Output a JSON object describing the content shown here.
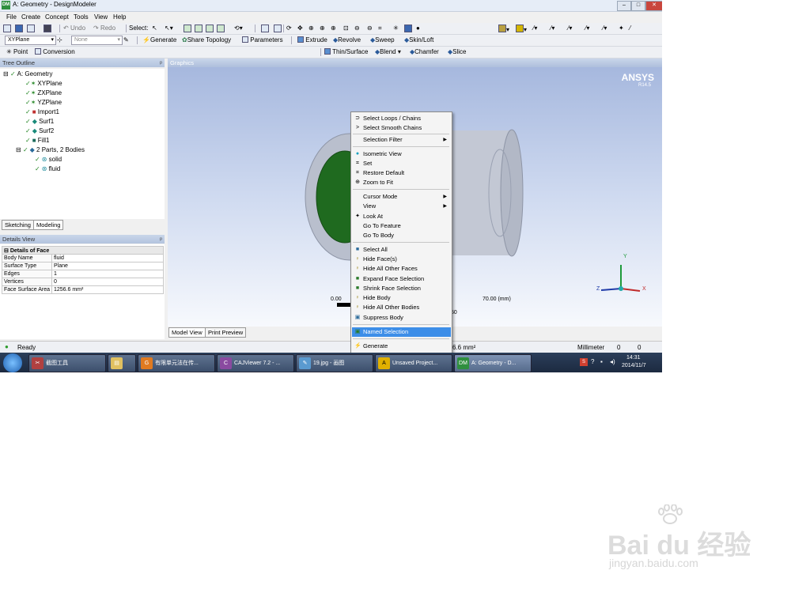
{
  "window": {
    "title": "A: Geometry - DesignModeler",
    "app_badge": "DM"
  },
  "menu": [
    "File",
    "Create",
    "Concept",
    "Tools",
    "View",
    "Help"
  ],
  "toolbar1": {
    "undo": "Undo",
    "redo": "Redo",
    "select": "Select:"
  },
  "toolbar2": {
    "plane": "XYPlane",
    "sketch": "None",
    "generate": "Generate",
    "share_topology": "Share Topology",
    "parameters": "Parameters",
    "extrude": "Extrude",
    "revolve": "Revolve",
    "sweep": "Sweep",
    "skin_loft": "Skin/Loft"
  },
  "toolbar3": {
    "point": "Point",
    "conversion": "Conversion",
    "thin_surface": "Thin/Surface",
    "blend": "Blend",
    "chamfer": "Chamfer",
    "slice": "Slice"
  },
  "tree": {
    "header": "Tree Outline",
    "nodes": [
      "A: Geometry",
      "XYPlane",
      "ZXPlane",
      "YZPlane",
      "Import1",
      "Surf1",
      "Surf2",
      "Fill1",
      "2 Parts, 2 Bodies",
      "solid",
      "fluid"
    ],
    "tabs": [
      "Sketching",
      "Modeling"
    ]
  },
  "details": {
    "header": "Details View",
    "section": "Details of Face",
    "rows": [
      [
        "Body Name",
        "fluid"
      ],
      [
        "Surface Type",
        "Plane"
      ],
      [
        "Edges",
        "1"
      ],
      [
        "Vertices",
        "0"
      ],
      [
        "Face Surface Area",
        "1256.6 mm²"
      ]
    ]
  },
  "graphics": {
    "header": "Graphics",
    "brand": "ANSYS",
    "version": "R14.5",
    "scale_left": "0.00",
    "scale_right": "70.00 (mm)",
    "scale_mid": "50",
    "axes": [
      "Y",
      "Z",
      "X"
    ],
    "tabs": [
      "Model View",
      "Print Preview"
    ]
  },
  "context_menu": {
    "items": [
      {
        "label": "Select Loops / Chains",
        "icon": "loop-icon"
      },
      {
        "label": "Select Smooth Chains",
        "icon": "chain-icon"
      },
      {
        "label": "Selection Filter",
        "icon": "",
        "submenu": true
      },
      {
        "label": "Isometric View",
        "icon": "isometric-icon"
      },
      {
        "label": "Set",
        "icon": "set-icon"
      },
      {
        "label": "Restore Default",
        "icon": "restore-icon"
      },
      {
        "label": "Zoom to Fit",
        "icon": "zoom-icon"
      },
      {
        "label": "Cursor Mode",
        "icon": "",
        "submenu": true
      },
      {
        "label": "View",
        "icon": "",
        "submenu": true
      },
      {
        "label": "Look At",
        "icon": "look-icon"
      },
      {
        "label": "Go To Feature",
        "icon": ""
      },
      {
        "label": "Go To Body",
        "icon": ""
      },
      {
        "label": "Select All",
        "icon": "select-all-icon"
      },
      {
        "label": "Hide Face(s)",
        "icon": "bulb-icon"
      },
      {
        "label": "Hide All Other Faces",
        "icon": "bulb-icon"
      },
      {
        "label": "Expand Face Selection",
        "icon": "expand-icon"
      },
      {
        "label": "Shrink Face Selection",
        "icon": "shrink-icon"
      },
      {
        "label": "Hide Body",
        "icon": "bulb-icon"
      },
      {
        "label": "Hide All Other Bodies",
        "icon": "bulb-icon"
      },
      {
        "label": "Suppress Body",
        "icon": "suppress-icon"
      },
      {
        "label": "Named Selection",
        "icon": "named-selection-icon"
      },
      {
        "label": "Generate",
        "icon": "lightning-icon"
      }
    ]
  },
  "statusbar": {
    "status": "Ready",
    "area": "6.6 mm²",
    "units": "Millimeter",
    "v1": "0",
    "v2": "0"
  },
  "taskbar": {
    "buttons": [
      "截图工具",
      "",
      "有限单元法在传...",
      "CAJViewer 7.2 - ...",
      "19.jpg - 画图",
      "Unsaved Project...",
      "A: Geometry - D..."
    ],
    "time": "14:31",
    "date": "2014/11/7"
  },
  "watermark": {
    "text": "Bai du 经验",
    "sub": "jingyan.baidu.com"
  },
  "colors": {
    "selected": "#3d8ee8",
    "face_green": "#1f6a1f",
    "body": "#b7bdcb"
  }
}
